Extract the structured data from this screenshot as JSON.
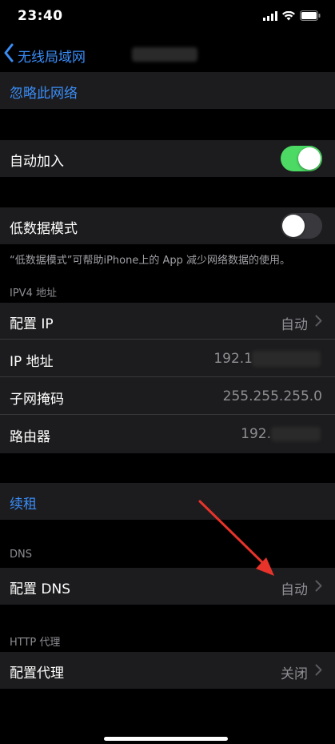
{
  "status": {
    "time": "23:40"
  },
  "nav": {
    "back_label": "无线局域网"
  },
  "ignore_network": "忽略此网络",
  "auto_join": {
    "label": "自动加入",
    "on": true
  },
  "low_data": {
    "label": "低数据模式",
    "on": false,
    "footnote": "“低数据模式”可帮助iPhone上的 App 减少网络数据的使用。"
  },
  "ipv4": {
    "header": "IPV4 地址",
    "rows": [
      {
        "label": "配置 IP",
        "value": "自动"
      },
      {
        "label": "IP 地址",
        "value": "192.1"
      },
      {
        "label": "子网掩码",
        "value": "255.255.255.0"
      },
      {
        "label": "路由器",
        "value": "192."
      }
    ]
  },
  "renew_lease": "续租",
  "dns": {
    "header": "DNS",
    "label": "配置 DNS",
    "value": "自动"
  },
  "proxy": {
    "header": "HTTP 代理",
    "label": "配置代理",
    "value": "关闭"
  },
  "colors": {
    "accent": "#3a8df7",
    "toggle_on": "#4cd964",
    "toggle_off": "#39393d",
    "annotation": "#e8332a"
  }
}
